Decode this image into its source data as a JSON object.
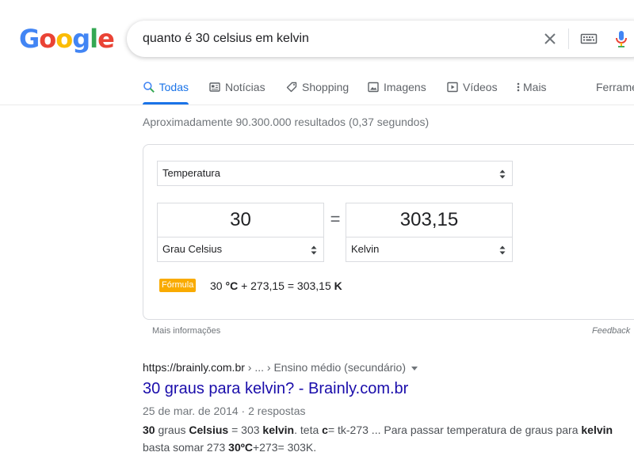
{
  "logo": {
    "letters": [
      "G",
      "o",
      "o",
      "g",
      "l",
      "e"
    ]
  },
  "search": {
    "query": "quanto é 30 celsius em kelvin"
  },
  "tabs": [
    {
      "label": "Todas",
      "icon": "search-icon"
    },
    {
      "label": "Notícias",
      "icon": "news-icon"
    },
    {
      "label": "Shopping",
      "icon": "tag-icon"
    },
    {
      "label": "Imagens",
      "icon": "image-icon"
    },
    {
      "label": "Vídeos",
      "icon": "video-icon"
    },
    {
      "label": "Mais",
      "icon": "more-vert-icon"
    },
    {
      "label": "Ferramentas"
    }
  ],
  "stats": "Aproximadamente 90.300.000 resultados (0,37 segundos)",
  "converter": {
    "unit_type": "Temperatura",
    "from_value": "30",
    "to_value": "303,15",
    "from_unit": "Grau Celsius",
    "to_unit": "Kelvin",
    "equals": "=",
    "formula_label": "Fórmula",
    "formula": {
      "a": "30 ",
      "a_unit": "°C",
      "b": " + 273,15 = 303,15 ",
      "b_unit": "K"
    }
  },
  "more_info": "Mais informações",
  "feedback": "Feedback",
  "result": {
    "url": "https://brainly.com.br",
    "breadcrumbs": " › ... › Ensino médio (secundário)",
    "title": "30 graus para kelvin? - Brainly.com.br",
    "date": "25 de mar. de 2014",
    "sep": " · ",
    "answers": "2 respostas",
    "snippet": [
      {
        "t": "30",
        "b": true
      },
      {
        "t": " graus ",
        "b": false
      },
      {
        "t": "Celsius",
        "b": true
      },
      {
        "t": " = 303 ",
        "b": false
      },
      {
        "t": "kelvin",
        "b": true
      },
      {
        "t": ". teta ",
        "b": false
      },
      {
        "t": "c",
        "b": true
      },
      {
        "t": "= tk-273 ... Para passar temperatura de graus para ",
        "b": false
      },
      {
        "t": "kelvin",
        "b": true
      },
      {
        "t": " basta somar 273 ",
        "b": false
      },
      {
        "t": "30ºC",
        "b": true
      },
      {
        "t": "+273= 303K.",
        "b": false
      }
    ]
  },
  "colors": {
    "accent": "#1a73e8",
    "link": "#1a0dab",
    "formula_badge": "#f9ab00"
  }
}
